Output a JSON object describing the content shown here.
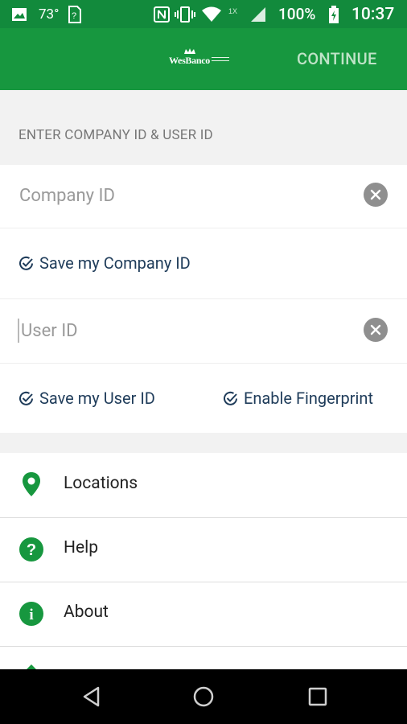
{
  "status_bar": {
    "temperature": "73°",
    "battery": "100%",
    "time": "10:37"
  },
  "app_bar": {
    "logo": "WesBanco",
    "continue_label": "CONTINUE"
  },
  "form": {
    "section_title": "ENTER COMPANY ID & USER ID",
    "company_id_placeholder": "Company ID",
    "save_company_id_label": "Save my Company ID",
    "user_id_placeholder": "User ID",
    "save_user_id_label": "Save my User ID",
    "enable_fingerprint_label": "Enable Fingerprint"
  },
  "menu": {
    "items": [
      {
        "label": "Locations",
        "icon": "location-pin-icon"
      },
      {
        "label": "Help",
        "icon": "help-icon"
      },
      {
        "label": "About",
        "icon": "info-icon"
      }
    ]
  },
  "colors": {
    "app_bar": "#17973f",
    "status_bar": "#128a3c",
    "accent_text": "#1f3c5a",
    "icon_green": "#17973f"
  }
}
